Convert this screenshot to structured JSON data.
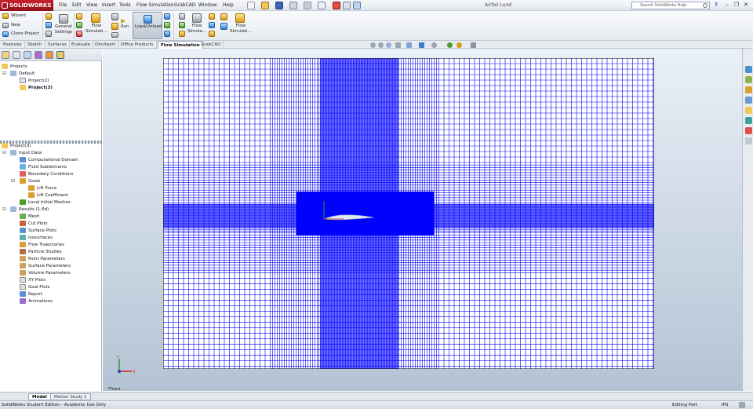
{
  "titlebar": {
    "logo": "SOLIDWORKS",
    "menus": [
      "File",
      "Edit",
      "View",
      "Insert",
      "Tools",
      "Flow Simulation",
      "GrabCAD",
      "Window",
      "Help"
    ],
    "doc_title": "Airfoil Lund",
    "search_placeholder": "Search SolidWorks Help",
    "help_icon": "?"
  },
  "ribbon": {
    "wizard": "Wizard",
    "new": "New",
    "clone": "Clone Project",
    "general_settings_1": "General",
    "general_settings_2": "Settings",
    "flow_sim_1": "Flow",
    "flow_sim_2": "Simulati...",
    "run": "Run",
    "load_unload": "Load/Unload",
    "flow_sim_b1": "Flow",
    "flow_sim_b2": "Simula...",
    "flow_sim_c1": "Flow",
    "flow_sim_c2": "Simulati..."
  },
  "tabs": [
    "Features",
    "Sketch",
    "Surfaces",
    "Evaluate",
    "DimXpert",
    "Office Products",
    "Flow Simulation",
    "GrabCAD"
  ],
  "active_tab": "Flow Simulation",
  "projects_tree": {
    "root": "Projects",
    "default": "Default",
    "items": [
      "Project(2)",
      "Project(3)"
    ]
  },
  "analysis_tree": {
    "root": "Project(3)",
    "input_data": "Input Data",
    "input_items": [
      "Computational Domain",
      "Fluid Subdomains",
      "Boundary Conditions",
      "Goals"
    ],
    "goal_items": [
      "Lift Force",
      "Lift Coefficient"
    ],
    "local_mesh": "Local Initial Meshes",
    "results": "Results (1.fld)",
    "result_items": [
      "Mesh",
      "Cut Plots",
      "Surface Plots",
      "Isosurfaces",
      "Flow Trajectories",
      "Particle Studies",
      "Point Parameters",
      "Surface Parameters",
      "Volume Parameters",
      "XY Plots",
      "Goal Plots",
      "Report",
      "Animations"
    ]
  },
  "viewport": {
    "view_label": "*Front"
  },
  "bottom_tabs": [
    "Model",
    "Motion Study 1"
  ],
  "status": {
    "left": "SolidWorks Student Edition - Academic Use Only",
    "right": "Editing Part",
    "mode": "IPS"
  },
  "colors": {
    "mesh": "#0000ff",
    "brand": "#c8202e"
  }
}
